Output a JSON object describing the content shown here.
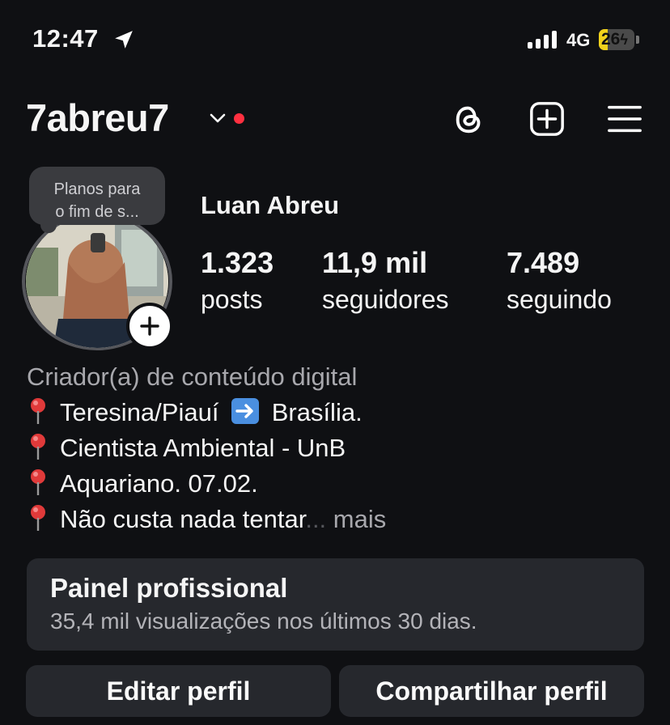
{
  "status_bar": {
    "time": "12:47",
    "network": "4G",
    "battery": "26",
    "battery_level": 0.26
  },
  "header": {
    "username": "7abreu7"
  },
  "note": {
    "line1": "Planos para",
    "line2": "o fim de s..."
  },
  "profile": {
    "name": "Luan Abreu",
    "stats": [
      {
        "value": "1.323",
        "label": "posts"
      },
      {
        "value": "11,9 mil",
        "label": "seguidores"
      },
      {
        "value": "7.489",
        "label": "seguindo"
      }
    ]
  },
  "bio": {
    "category": "Criador(a) de conteúdo digital",
    "line1_a": "Teresina/Piauí",
    "line1_b": "Brasília.",
    "line2": "Cientista Ambiental - UnB",
    "line3": "Aquariano. 07.02.",
    "line4": "Não custa nada tentar",
    "ellipsis": "...",
    "more": "mais"
  },
  "dashboard": {
    "title": "Painel profissional",
    "subtitle": "35,4 mil visualizações nos últimos 30 dias."
  },
  "buttons": {
    "edit": "Editar perfil",
    "share": "Compartilhar perfil"
  },
  "colors": {
    "background": "#0f1013",
    "card": "#26282d",
    "notification_dot": "#ff3040",
    "battery": "#f2d21b",
    "muted_text": "#a8a8ad"
  }
}
